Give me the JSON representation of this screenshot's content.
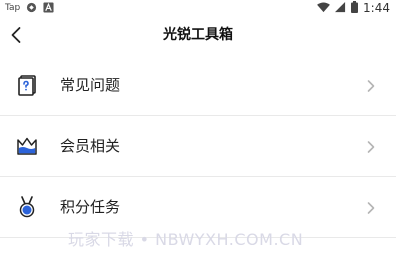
{
  "status_bar": {
    "app_label": "Tap",
    "time": "1:44",
    "icons": [
      "sync-icon",
      "a-icon",
      "wifi-icon",
      "signal-icon",
      "battery-icon"
    ]
  },
  "header": {
    "title": "光锐工具箱",
    "back_icon": "chevron-left-icon"
  },
  "menu": {
    "items": [
      {
        "label": "常见问题",
        "icon": "question-document-icon"
      },
      {
        "label": "会员相关",
        "icon": "crown-icon"
      },
      {
        "label": "积分任务",
        "icon": "medal-icon"
      }
    ]
  },
  "watermark": "玩家下载 • NBWYXH.COM.CN",
  "colors": {
    "crown_fill": "#2c63d9",
    "medal_fill": "#2c63d9",
    "chevron": "#b5b5b5",
    "divider": "#e9e9e9"
  }
}
